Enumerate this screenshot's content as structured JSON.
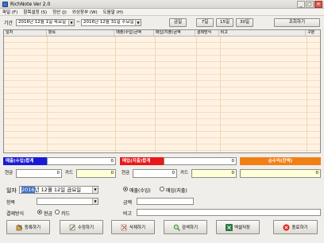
{
  "window": {
    "title": "RichNote Ver 2.0",
    "minimize": "_",
    "maximize": "□",
    "close": "✕"
  },
  "menu": [
    "파일 (F)",
    "항목설정 (S)",
    "정산 (J)",
    "외상장부 (W)",
    "도움말 (H)"
  ],
  "toolbar": {
    "period_label": "기간",
    "start_date": "2016년 12월  1일 목요일",
    "separator": "~",
    "end_date": "2016년 12월 31일 수요일",
    "today_button": "금일",
    "days7_button": "7일",
    "days15_button": "15일",
    "days30_button": "30일",
    "search_button": "조회하기"
  },
  "grid": {
    "columns": [
      "일자",
      "항목",
      "매출(수입)금액",
      "매입(지출)금액",
      "결제방식",
      "비고",
      "구분"
    ],
    "rows": []
  },
  "summary": {
    "sales_label": "매출(수입)합계",
    "sales_total": "0",
    "purchase_label": "매입(지출)합계",
    "purchase_total": "0",
    "net_label": "순수익(잔액)",
    "net_total": "0",
    "sales_cash_label": "현금",
    "sales_cash_value": "0",
    "sales_card_label": "카드",
    "sales_card_value": "0",
    "purchase_cash_label": "현금",
    "purchase_cash_value": "0",
    "purchase_card_label": "카드",
    "purchase_card_value": "0",
    "net_value": "0",
    "colors": {
      "sales": "#1a1ad6",
      "purchase": "#e8181a",
      "net": "#f27f14"
    }
  },
  "form": {
    "date_label": "일자",
    "date_year_highlight": "2016",
    "date_rest": "년 12월 12일 금요일",
    "item_label": "항목",
    "item_value": "",
    "payment_label": "결제방식",
    "payment_cash": "현금",
    "payment_card": "카드",
    "payment_selected": "cash",
    "type_sales": "매출(수입)",
    "type_purchase": "매입(지출)",
    "type_selected": "sales",
    "amount_label": "금액",
    "amount_value": "",
    "memo_label": "비고",
    "memo_value": ""
  },
  "buttons": {
    "register": "등록하기",
    "modify": "수정하기",
    "delete": "삭제하기",
    "search": "검색하기",
    "excel": "엑셀저장",
    "exit": "종료하기"
  }
}
